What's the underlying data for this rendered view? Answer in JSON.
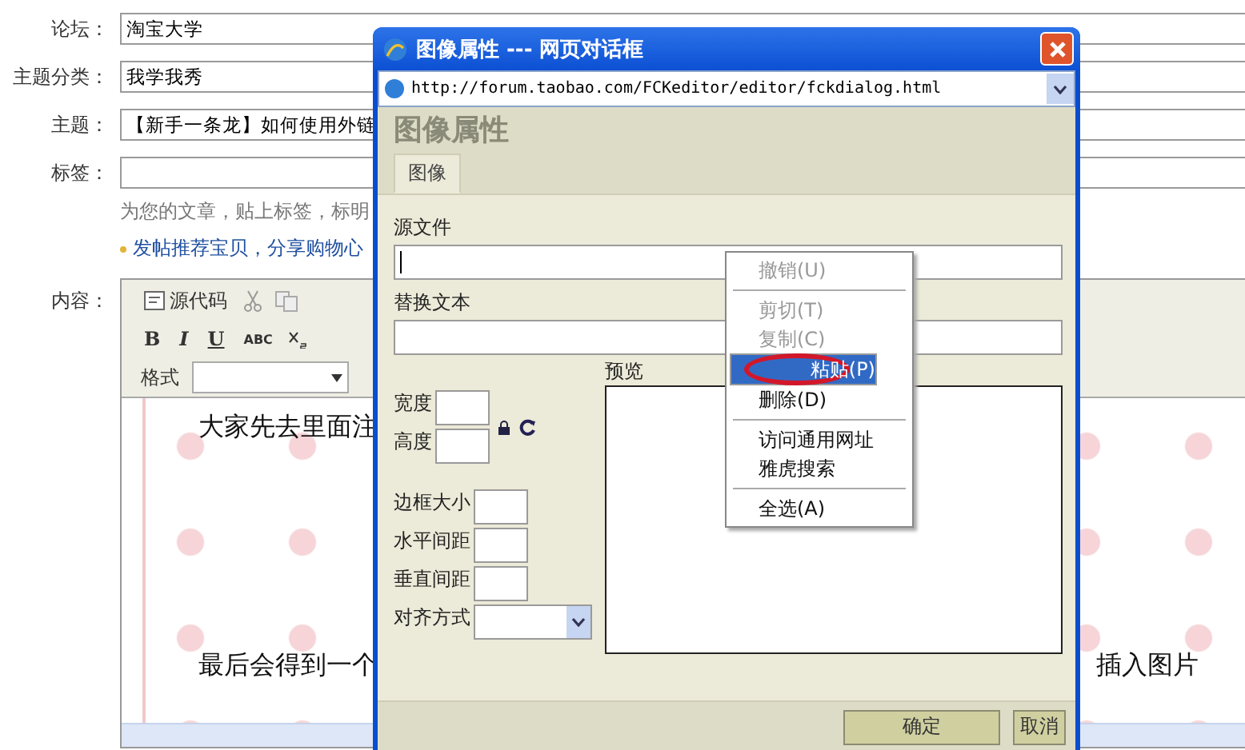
{
  "form": {
    "rows": [
      {
        "label": "论坛：",
        "value": "淘宝大学"
      },
      {
        "label": "主题分类：",
        "value": "我学我秀"
      },
      {
        "label": "主题：",
        "value": "【新手一条龙】如何使用外链"
      },
      {
        "label": "标签："
      }
    ],
    "tag_hint": "为您的文章，贴上标签，标明",
    "tip_link": "发帖推荐宝贝，分享购物心",
    "content_label": "内容："
  },
  "editor": {
    "source_button": "源代码",
    "format_buttons": [
      "B",
      "I",
      "U",
      "ABC"
    ],
    "format_label": "格式",
    "paragraphs": [
      {
        "left": "大家先去里面注"
      },
      {
        "left": "最后会得到一个",
        "right": "插入图片"
      }
    ]
  },
  "dialog": {
    "title": "图像属性 --- 网页对话框",
    "url": "http://forum.taobao.com/FCKeditor/editor/fckdialog.html",
    "heading": "图像属性",
    "tabs": [
      {
        "label": "图像",
        "selected": true
      }
    ],
    "source_label": "源文件",
    "alt_label": "替换文本",
    "preview_label": "预览",
    "size_fields": [
      {
        "label": "宽度"
      },
      {
        "label": "高度"
      }
    ],
    "spacing_fields": [
      {
        "label": "边框大小"
      },
      {
        "label": "水平间距"
      },
      {
        "label": "垂直间距"
      }
    ],
    "align_label": "对齐方式",
    "buttons": [
      {
        "label": "确定",
        "kind": "primary"
      },
      {
        "label": "取消",
        "kind": "secondary"
      }
    ]
  },
  "context_menu": [
    {
      "kind": "item",
      "label": "撤销(U)",
      "disabled": true,
      "selected": false,
      "circled": false
    },
    {
      "kind": "separator"
    },
    {
      "kind": "item",
      "label": "剪切(T)",
      "disabled": true,
      "selected": false,
      "circled": false
    },
    {
      "kind": "item",
      "label": "复制(C)",
      "disabled": true,
      "selected": false,
      "circled": false
    },
    {
      "kind": "item",
      "label": "粘贴(P)",
      "disabled": false,
      "selected": true,
      "circled": true
    },
    {
      "kind": "item",
      "label": "删除(D)",
      "disabled": false,
      "selected": false,
      "circled": false
    },
    {
      "kind": "separator"
    },
    {
      "kind": "item",
      "label": "访问通用网址",
      "disabled": false,
      "selected": false,
      "circled": false
    },
    {
      "kind": "item",
      "label": "雅虎搜索",
      "disabled": false,
      "selected": false,
      "circled": false
    },
    {
      "kind": "separator"
    },
    {
      "kind": "item",
      "label": "全选(A)",
      "disabled": false,
      "selected": false,
      "circled": false
    }
  ]
}
